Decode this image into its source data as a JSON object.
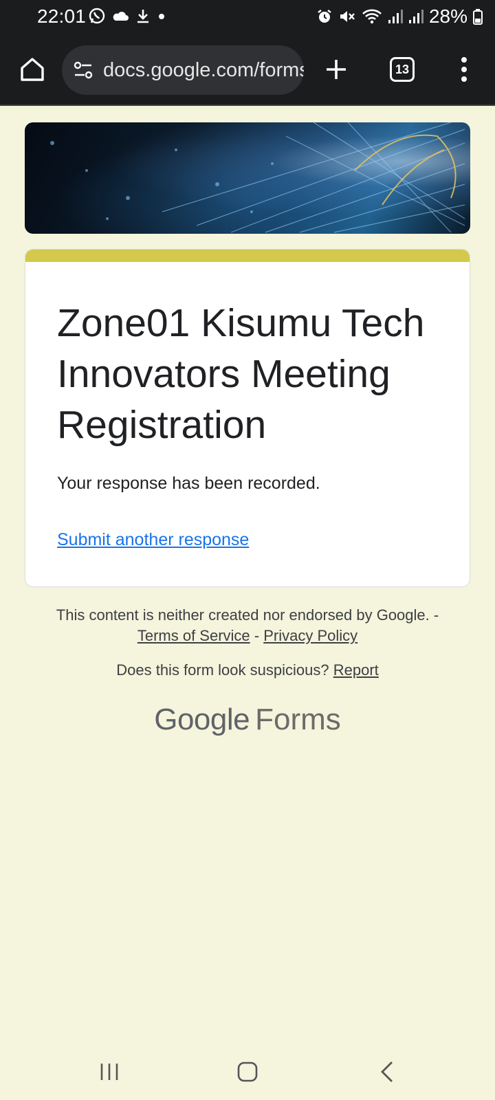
{
  "status_bar": {
    "time": "22:01",
    "battery": "28%",
    "left_icons": [
      "whatsapp-icon",
      "cloud-icon",
      "download-icon",
      "dot-icon"
    ],
    "right_icons": [
      "alarm-icon",
      "mute-icon",
      "wifi-icon",
      "signal-icon",
      "signal-icon",
      "battery-icon"
    ]
  },
  "browser": {
    "url": "docs.google.com/forms",
    "tab_count": "13"
  },
  "form": {
    "title": "Zone01 Kisumu Tech Innovators Meeting Registration",
    "confirmation": "Your response has been recorded.",
    "submit_another": "Submit another response",
    "accent_color": "#d3c94a",
    "background_color": "#f5f4dc"
  },
  "footer": {
    "disclaimer": "This content is neither created nor endorsed by Google. -",
    "terms": "Terms of Service",
    "separator": "-",
    "privacy": "Privacy Policy",
    "suspicious": "Does this form look suspicious?",
    "report": "Report",
    "logo_google": "Google",
    "logo_forms": "Forms"
  }
}
